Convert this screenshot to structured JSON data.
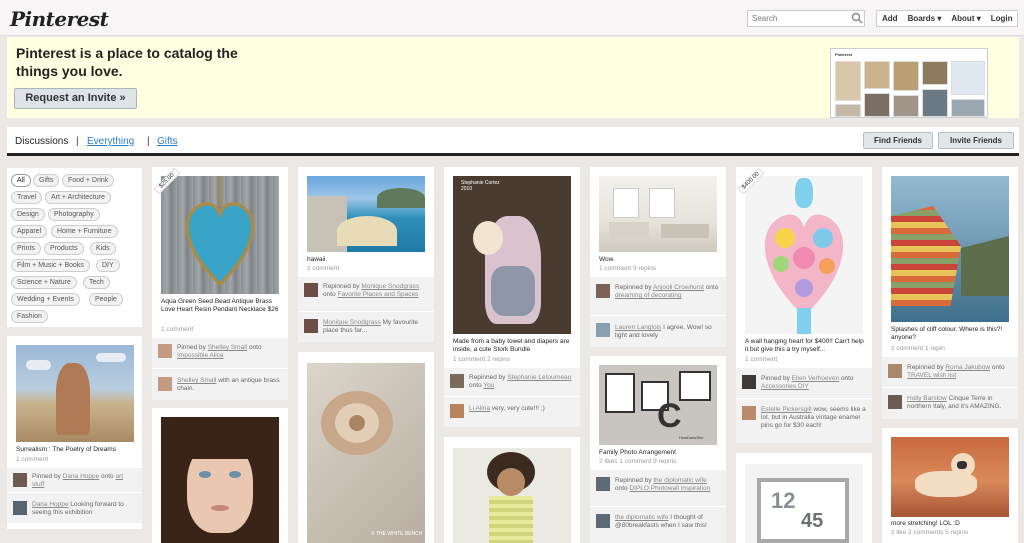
{
  "header": {
    "logo": "Pinterest",
    "search_placeholder": "Search",
    "nav": [
      "Add",
      "Boards ▾",
      "About ▾",
      "Login"
    ]
  },
  "banner": {
    "text": "Pinterest is a place to catalog the things you love.",
    "button": "Request an Invite »",
    "preview_logo": "Pinterest"
  },
  "tabs": {
    "active": "Discussions",
    "everything": "Everything",
    "gifts": "Gifts",
    "sep": "|",
    "find": "Find Friends",
    "invite": "Invite Friends"
  },
  "categories": [
    "All",
    "Gifts",
    "Food + Drink",
    "Travel",
    "Art + Architecture",
    "Design",
    "Photography",
    "Apparel",
    "Home + Furniture",
    "Prints",
    "Products",
    "Kids",
    "Film + Music + Books",
    "DIY",
    "Science + Nature",
    "Tech",
    "Wedding + Events",
    "People",
    "Fashion"
  ],
  "pins": {
    "surreal": {
      "caption": "Surrealism : The Poetry of Dreams",
      "meta": "1 comment",
      "a1_pre": "Pinned by ",
      "a1_user": "Dana Hoppe",
      "a1_mid": " onto ",
      "a1_board": "art stuff",
      "a2_user": "Dana Hoppe",
      "a2_text": " Looking forward to seeing this exhibition"
    },
    "heart": {
      "price": "$25.00",
      "caption": "Aqua Green Seed Bead Antique Brass Love Heart Resin Pendant Necklace $26",
      "meta": "1 comment",
      "a1_pre": "Pinned by ",
      "a1_user": "Shelley Small",
      "a1_mid": " onto ",
      "a1_board": "Impossible Alice",
      "a2_user": "Shelley Small",
      "a2_text": " with an antique brass chain."
    },
    "hawaii": {
      "caption": "hawaii.",
      "meta": "1 comment",
      "a1_pre": "Repinned by ",
      "a1_user": "Monique Snodgrass",
      "a1_mid": " onto ",
      "a1_board": "Favorite Places and Spaces",
      "a2_user": "Monique Snodgrass",
      "a2_text": " My favourite place thus far..."
    },
    "stork": {
      "overlay": "Stephanie Cortez 2010",
      "caption": "Made from a baby towel and diapers are inside, a cute Stork Bundle",
      "meta": "1 comment  2 repins",
      "a1_pre": "Repinned by ",
      "a1_user": "Stephanie Letourneau",
      "a1_mid": " onto ",
      "a1_board": "You",
      "a2_user": "Li Alina",
      "a2_text": " very, very cute!!! ;)"
    },
    "room": {
      "caption": "Wow.",
      "meta": "1 comment  3 repins",
      "a1_pre": "Repinned by ",
      "a1_user": "Anjooli Crowhurst",
      "a1_mid": " onto ",
      "a1_board": "dreaming of decorating",
      "a2_user": "Lauren Langlois",
      "a2_text": " I agree, Wow! so light and lovely"
    },
    "family": {
      "caption": "Family Photo Arrangement",
      "meta": "2 likes  1 comment  9 repins",
      "a1_pre": "Repinned by ",
      "a1_user": "the diplomatic wife",
      "a1_mid": " onto ",
      "a1_board": "DIPLO Photowall inspiration",
      "a2_user": "the diplomatic wife",
      "a2_text": " I thought of @80breakfasts when I saw this!"
    },
    "flowers": {
      "price": "$400.00",
      "caption": "A wall hanging heart for $400!! Can't help it but give this a try myself...",
      "meta": "1 comment",
      "a1_pre": "Pinned by ",
      "a1_user": "Ellen Verhoeven",
      "a1_mid": " onto ",
      "a1_board": "Accessories DIY",
      "a2_user": "Estelle Pickersgill",
      "a2_text": " wow, seems like a lot, but in Australia vintage enamel pins go for $30 each!"
    },
    "cinque": {
      "caption": "Splashes of cliff colour. Where is this?! anyone?",
      "meta": "1 comment  1 repin",
      "a1_pre": "Repinned by ",
      "a1_user": "Roma Jakubow",
      "a1_mid": " onto ",
      "a1_board": "TRAVEL wish list",
      "a2_user": "Holly Barstow",
      "a2_text": " Cinque Terre in northern Italy, and it's AMAZING."
    },
    "dog": {
      "caption": "more stretching! LOL :D",
      "meta": "1 like  2 comments  5 repins"
    },
    "rose": {
      "watermark": "© THE WHITE BENCH"
    },
    "numbers": {
      "watermark": "HowDoesShe"
    }
  }
}
